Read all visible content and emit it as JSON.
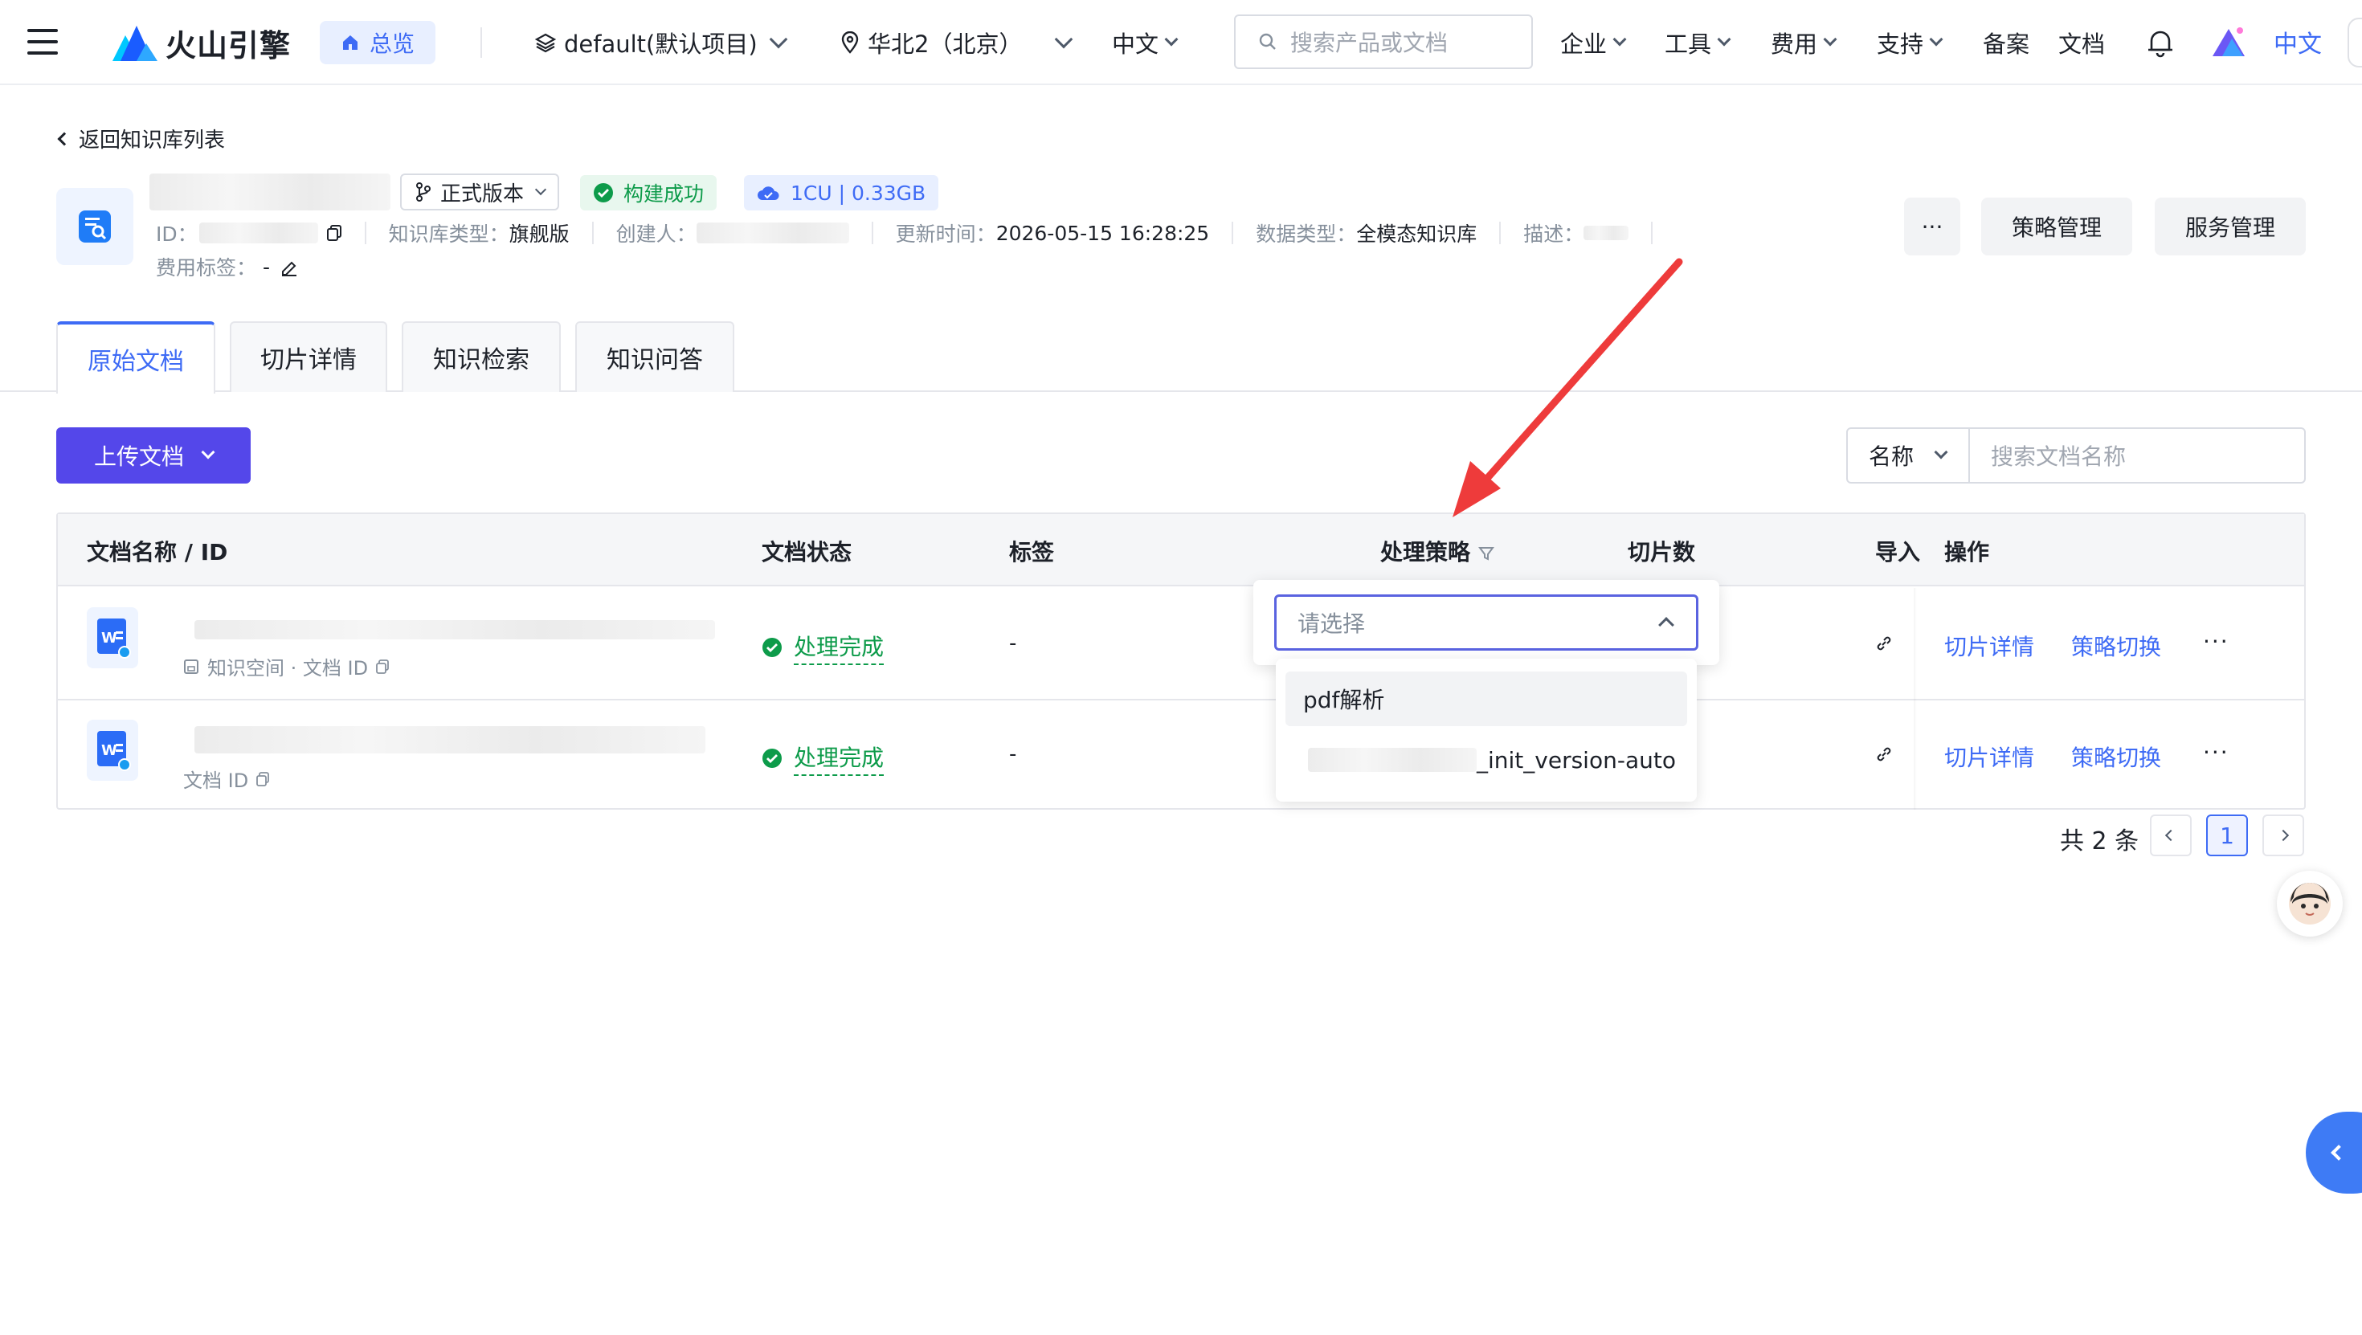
{
  "topnav": {
    "logo_text": "火山引擎",
    "overview": "总览",
    "project": "default(默认项目)",
    "region": "华北2（北京）",
    "language": "中文",
    "search_placeholder": "搜索产品或文档",
    "menus": [
      "企业",
      "工具",
      "费用",
      "支持",
      "备案",
      "文档"
    ],
    "lang_link": "中文"
  },
  "header": {
    "back_label": "返回知识库列表",
    "version": "正式版本",
    "build_status": "构建成功",
    "resource": "1CU | 0.33GB",
    "id_label": "ID：",
    "kb_type_label": "知识库类型：",
    "kb_type_value": "旗舰版",
    "creator_label": "创建人：",
    "updated_label": "更新时间：",
    "updated_value": "2026-05-15 16:28:25",
    "data_type_label": "数据类型：",
    "data_type_value": "全模态知识库",
    "desc_label": "描述：",
    "fee_label": "费用标签：",
    "fee_value": "-",
    "more": "···",
    "strategy_btn": "策略管理",
    "service_btn": "服务管理"
  },
  "tabs": [
    {
      "label": "原始文档",
      "active": true
    },
    {
      "label": "切片详情",
      "active": false
    },
    {
      "label": "知识检索",
      "active": false
    },
    {
      "label": "知识问答",
      "active": false
    }
  ],
  "toolbar": {
    "upload_label": "上传文档",
    "filter_field": "名称",
    "search_placeholder": "搜索文档名称"
  },
  "table": {
    "columns": [
      "文档名称 / ID",
      "文档状态",
      "标签",
      "处理策略",
      "切片数",
      "导入",
      "操作"
    ],
    "rows": [
      {
        "subline": "知识空间 · 文档 ID",
        "status": "处理完成",
        "tag": "-",
        "op1": "切片详情",
        "op2": "策略切换",
        "more": "···"
      },
      {
        "subline": "文档 ID",
        "status": "处理完成",
        "tag": "-",
        "op1": "切片详情",
        "op2": "策略切换",
        "more": "···"
      }
    ]
  },
  "dropdown": {
    "placeholder": "请选择",
    "options": [
      "pdf解析",
      "_init_version-auto"
    ]
  },
  "pagination": {
    "total": "共 2 条",
    "current": "1"
  },
  "colors": {
    "accent": "#3e6bf5",
    "primary_button": "#5447ea",
    "success": "#0d9b4a",
    "annotation_arrow": "#ee3b3b"
  }
}
